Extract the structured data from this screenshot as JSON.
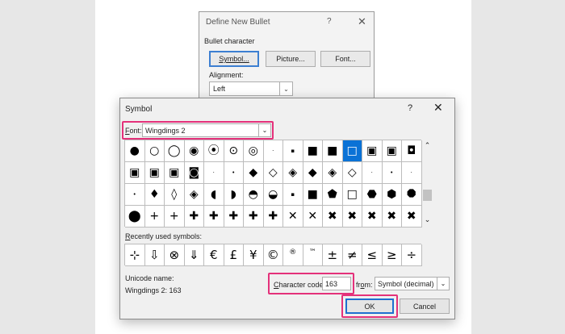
{
  "bg_dialog": {
    "title": "Define New Bullet",
    "help": "?",
    "close": "✕",
    "group_label": "Bullet character",
    "symbol_button": "Symbol...",
    "picture_button": "Picture...",
    "font_button": "Font...",
    "alignment_label": "Alignment:",
    "alignment_value": "Left",
    "dropdown_arrow": "⌄"
  },
  "symbol_dialog": {
    "title": "Symbol",
    "help": "?",
    "close": "✕",
    "font_label_key": "F",
    "font_label_rest": "ont:",
    "font_value": "Wingdings 2",
    "dropdown_arrow": "⌄",
    "grid": [
      [
        "●",
        "○",
        "◯",
        "◉",
        "⦿",
        "⊙",
        "◎",
        "·",
        "▪",
        "■",
        "■",
        "□",
        "▣",
        "▣",
        "◘"
      ],
      [
        "▣",
        "▣",
        "▣",
        "◙",
        "·",
        "•",
        "◆",
        "◇",
        "◈",
        "◆",
        "◈",
        "◇",
        "·",
        "•",
        "·"
      ],
      [
        "•",
        "♦",
        "◊",
        "◈",
        "◖",
        "◗",
        "◓",
        "◒",
        "▪",
        "■",
        "⬟",
        "□",
        "⬣",
        "⬢",
        "⯃"
      ],
      [
        "⬤",
        "+",
        "+",
        "✚",
        "✚",
        "✚",
        "✚",
        "✚",
        "✕",
        "✕",
        "✖",
        "✖",
        "✖",
        "✖",
        "✖"
      ]
    ],
    "selected_row": 0,
    "selected_col": 11,
    "scroll_up": "⌃",
    "scroll_down": "⌄",
    "recent_label_key": "R",
    "recent_label_rest": "ecently used symbols:",
    "recent": [
      "⊹",
      "⇩",
      "⊗",
      "⇓",
      "€",
      "£",
      "¥",
      "©",
      "®",
      "™",
      "±",
      "≠",
      "≤",
      "≥",
      "÷"
    ],
    "unicode_name_label": "Unicode name:",
    "unicode_name_value": "Wingdings 2: 163",
    "char_code_label_key": "C",
    "char_code_label_rest": "haracter code:",
    "char_code_value": "163",
    "from_label_pre": "fr",
    "from_label_key": "o",
    "from_label_post": "m:",
    "from_value": "Symbol (decimal)",
    "ok": "OK",
    "cancel": "Cancel"
  },
  "colors": {
    "highlight": "#e4317a",
    "selection": "#0a72d6",
    "ok_border": "#1f6fd0"
  }
}
